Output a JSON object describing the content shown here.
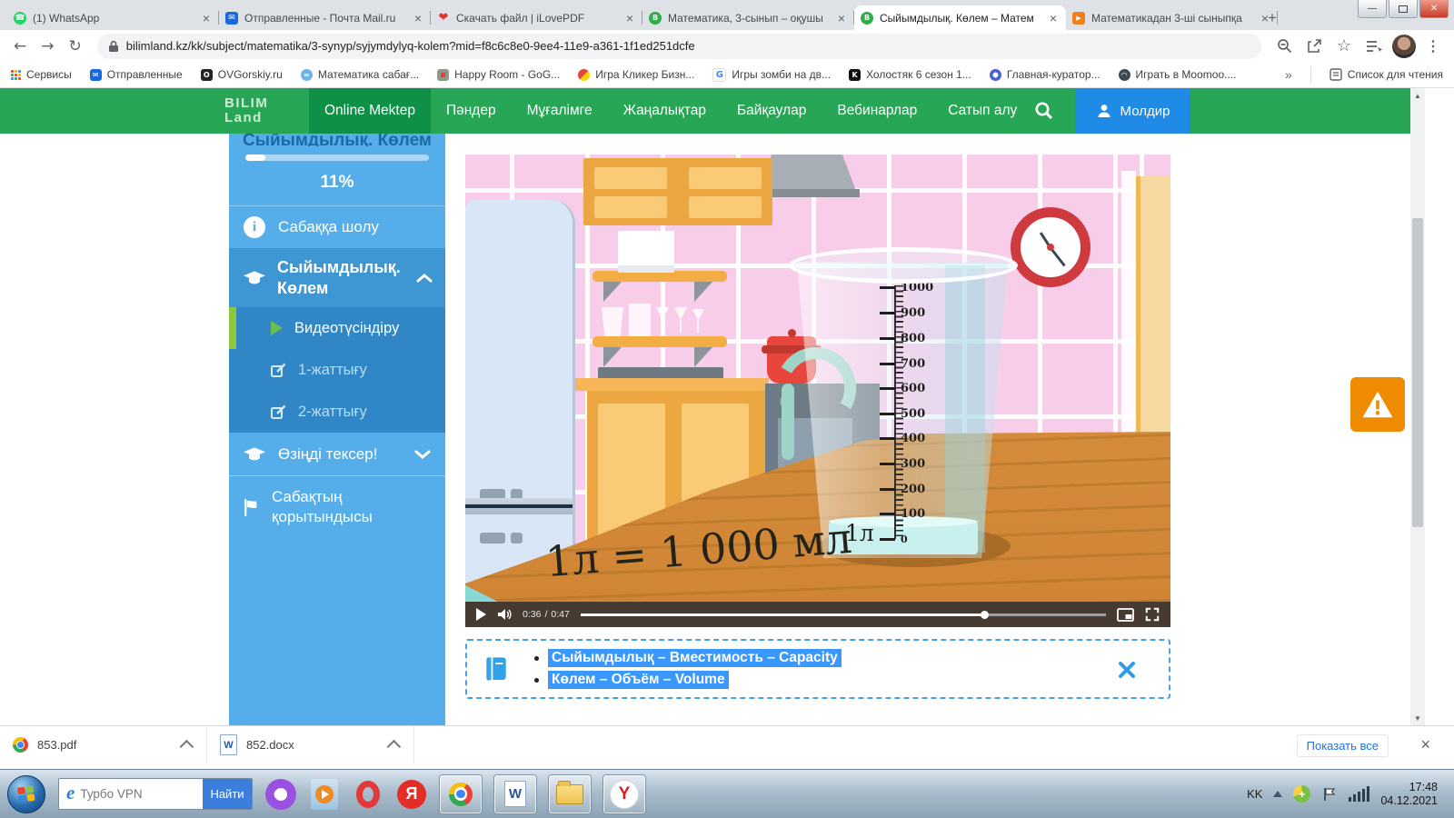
{
  "browser": {
    "tabs": [
      {
        "title": "(1) WhatsApp",
        "icon": "whatsapp-icon"
      },
      {
        "title": "Отправленные - Почта Mail.ru",
        "icon": "mailru-icon"
      },
      {
        "title": "Скачать файл | iLovePDF",
        "icon": "heart-icon"
      },
      {
        "title": "Математика, 3-сынып – оқушы",
        "icon": "bilimland-icon"
      },
      {
        "title": "Сыйымдылық. Көлем – Матем",
        "icon": "bilimland-icon"
      },
      {
        "title": "Математикадан 3-ші сыныпқа",
        "icon": "videouroki-icon"
      }
    ],
    "url": "bilimland.kz/kk/subject/matematika/3-synyp/syjymdylyq-kolem?mid=f8c6c8e0-9ee4-11e9-a361-1f1ed251dcfe",
    "bookmarks": [
      {
        "label": "Сервисы"
      },
      {
        "label": "Отправленные"
      },
      {
        "label": "OVGorskiy.ru"
      },
      {
        "label": "Математика сабағ..."
      },
      {
        "label": "Happy Room - GoG..."
      },
      {
        "label": "Игра Кликер Бизн..."
      },
      {
        "label": "Игры зомби на дв..."
      },
      {
        "label": "Холостяк 6 сезон 1..."
      },
      {
        "label": "Главная-куратор..."
      },
      {
        "label": "Играть в Moomoo...."
      }
    ],
    "bookmarks_overflow": "»",
    "reading_list": "Список для чтения"
  },
  "navbar": {
    "logo": [
      "BILIM",
      "Land"
    ],
    "items": [
      {
        "label": "Online Mektep",
        "active": true
      },
      {
        "label": "Пәндер"
      },
      {
        "label": "Мұғалімге"
      },
      {
        "label": "Жаңалықтар"
      },
      {
        "label": "Байқаулар"
      },
      {
        "label": "Вебинарлар"
      },
      {
        "label": "Сатып алу"
      }
    ],
    "user": "Молдир"
  },
  "sidebar": {
    "scrolled_title": "Сыйымдылық. Көлем",
    "progress_label": "11%",
    "progress_value": 11,
    "overview_label": "Сабаққа шолу",
    "section_label": "Сыйымдылық. Көлем",
    "lessons": [
      {
        "label": "Видеотүсіндіру",
        "active": true
      },
      {
        "label": "1-жаттығу"
      },
      {
        "label": "2-жаттығу"
      }
    ],
    "self_check_label": "Өзіңді тексер!",
    "summary_label": "Сабақтың қорытындысы"
  },
  "video": {
    "formula": "1л = 1 000 мл",
    "scale_labels": [
      "1000",
      "900",
      "800",
      "700",
      "600",
      "500",
      "400",
      "300",
      "200",
      "100",
      "0"
    ],
    "scale_unit": "1л",
    "time_current": "0:36",
    "time_separator": "/",
    "time_total": "0:47",
    "progress_percent": 77
  },
  "note": {
    "bullets": [
      "Сыйымдылық – Вместимость – Capacity",
      "Көлем – Объём – Volume"
    ]
  },
  "downloads": {
    "files": [
      {
        "name": "853.pdf",
        "icon": "chrome-file-icon"
      },
      {
        "name": "852.docx",
        "icon": "word-file-icon"
      }
    ],
    "show_all": "Показать все"
  },
  "taskbar": {
    "vpn": "Турбо VPN",
    "search_button": "Найти",
    "language": "KK",
    "time": "17:48",
    "date": "04.12.2021"
  }
}
